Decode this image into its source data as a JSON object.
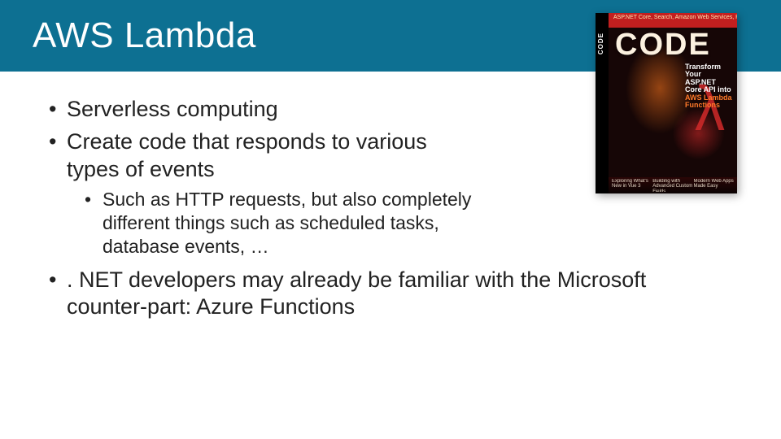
{
  "title": "AWS Lambda",
  "bullets": {
    "l1": [
      "Serverless computing",
      "Create code that responds to various types of events",
      ". NET developers may already be familiar with the Microsoft counter-part: Azure Functions"
    ],
    "l2": [
      "Such as HTTP requests, but also completely different things such as scheduled tasks, database events, …"
    ]
  },
  "cover": {
    "brand": "CODE",
    "spine": "CODE",
    "top_strip": "ASP.NET Core, Search, Amazon Web Services, Power Query",
    "headline_l1": "Transform",
    "headline_l2": "Your ASP.NET",
    "headline_l3": "Core API into",
    "headline_l4": "AWS Lambda",
    "headline_l5": "Functions",
    "bottom_a": "Exploring What's New in Vue 3",
    "bottom_b": "Building with Advanced Custom Fields",
    "bottom_c": "Modern Web Apps Made Easy"
  }
}
